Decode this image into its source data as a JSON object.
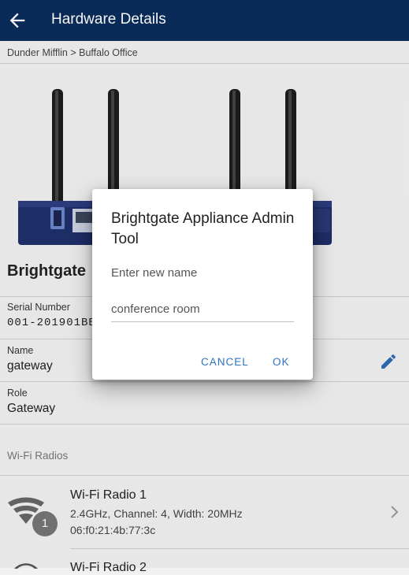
{
  "appbar": {
    "title": "Hardware Details"
  },
  "breadcrumb": "Dunder Mifflin > Buffalo Office",
  "device": {
    "name": "Brightgate"
  },
  "details": {
    "serial_label": "Serial Number",
    "serial_value": "001-201901BB",
    "name_label": "Name",
    "name_value": "gateway",
    "role_label": "Role",
    "role_value": "Gateway"
  },
  "section": {
    "title": "Wi-Fi Radios"
  },
  "radios": [
    {
      "title": "Wi-Fi Radio 1",
      "info": "2.4GHz, Channel: 4, Width: 20MHz",
      "mac": "06:f0:21:4b:77:3c",
      "badge": "1"
    },
    {
      "title": "Wi-Fi Radio 2"
    }
  ],
  "dialog": {
    "title": "Brightgate Appliance Admin Tool",
    "prompt": "Enter new name",
    "input_value": "conference room",
    "cancel_label": "CANCEL",
    "ok_label": "OK"
  },
  "colors": {
    "appbar": "#0b2d5b",
    "accent": "#2f74c0"
  }
}
